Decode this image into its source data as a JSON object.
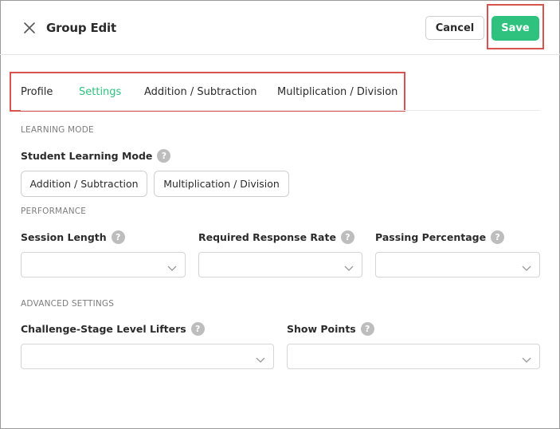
{
  "header": {
    "title": "Group Edit",
    "cancel_label": "Cancel",
    "save_label": "Save"
  },
  "tabs": [
    {
      "label": "Profile",
      "active": false
    },
    {
      "label": "Settings",
      "active": true
    },
    {
      "label": "Addition / Subtraction",
      "active": false
    },
    {
      "label": "Multiplication / Division",
      "active": false
    }
  ],
  "learning_mode": {
    "section_title": "LEARNING MODE",
    "field_label": "Student Learning Mode",
    "options": [
      "Addition / Subtraction",
      "Multiplication / Division"
    ]
  },
  "performance": {
    "section_title": "PERFORMANCE",
    "fields": [
      {
        "label": "Session Length",
        "value": ""
      },
      {
        "label": "Required Response Rate",
        "value": ""
      },
      {
        "label": "Passing Percentage",
        "value": ""
      }
    ]
  },
  "advanced": {
    "section_title": "ADVANCED SETTINGS",
    "fields": [
      {
        "label": "Challenge-Stage Level Lifters",
        "value": ""
      },
      {
        "label": "Show Points",
        "value": ""
      }
    ]
  },
  "help_glyph": "?",
  "colors": {
    "accent": "#2ec27e",
    "highlight": "#d9534f",
    "help_icon": "#bdbdbd"
  },
  "icons": {
    "close": "close-icon",
    "help": "help-icon",
    "dropdown": "chevron-down-icon"
  }
}
